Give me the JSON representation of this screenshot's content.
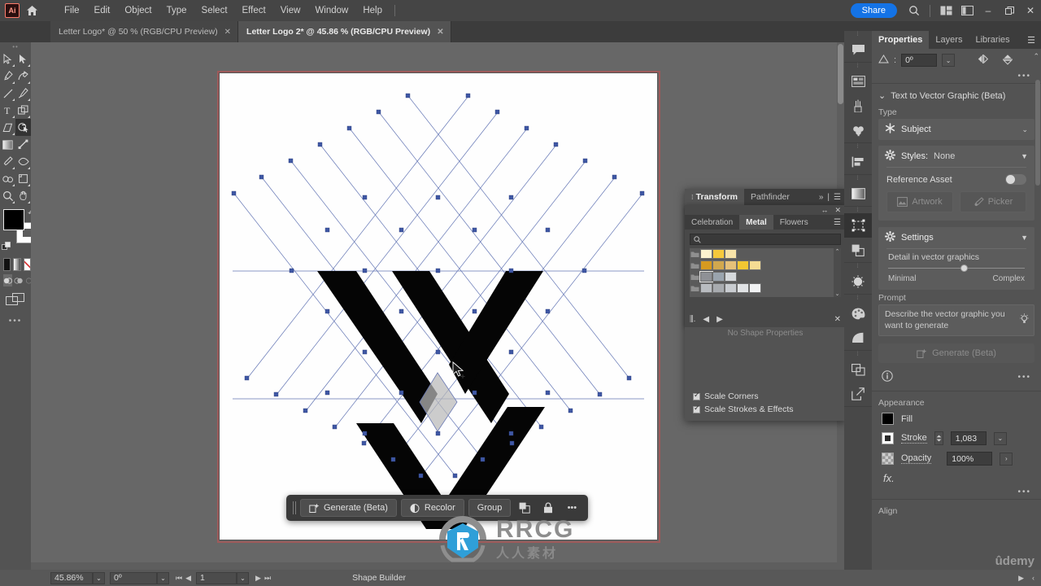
{
  "app": {
    "logo": "Ai",
    "home_icon": "home-icon",
    "menus": [
      "File",
      "Edit",
      "Object",
      "Type",
      "Select",
      "Effect",
      "View",
      "Window",
      "Help"
    ],
    "share_label": "Share",
    "search_icon": "search-icon",
    "arrange_icon": "arrange-documents-icon",
    "workspace_icon": "workspace-panel-icon",
    "minimize": "–",
    "maximize": "❐",
    "close": "✕"
  },
  "tabs": [
    {
      "label": "Letter Logo* @ 50 % (RGB/CPU Preview)",
      "active": false,
      "close": "✕"
    },
    {
      "label": "Letter  Logo 2* @ 45.86 % (RGB/CPU Preview)",
      "active": true,
      "close": "✕"
    }
  ],
  "toolbar": {
    "grip": "••",
    "tools": [
      {
        "name": "selection-tool",
        "selected": false,
        "sub": true
      },
      {
        "name": "direct-selection-tool",
        "selected": false,
        "sub": true
      },
      {
        "name": "pen-tool",
        "selected": false,
        "sub": true
      },
      {
        "name": "curvature-tool",
        "selected": false,
        "sub": true
      },
      {
        "name": "line-segment-tool",
        "selected": false,
        "sub": true
      },
      {
        "name": "paintbrush-tool",
        "selected": false,
        "sub": true
      },
      {
        "name": "type-tool",
        "selected": false,
        "sub": true
      },
      {
        "name": "shape-tool",
        "selected": false,
        "sub": true
      },
      {
        "name": "eraser-tool",
        "selected": false,
        "sub": true
      },
      {
        "name": "shape-builder-tool",
        "selected": true,
        "sub": false
      },
      {
        "name": "gradient-tool",
        "selected": false,
        "sub": false
      },
      {
        "name": "free-transform-tool",
        "selected": false,
        "sub": false
      },
      {
        "name": "eyedropper-tool",
        "selected": false,
        "sub": true
      },
      {
        "name": "width-tool",
        "selected": false,
        "sub": true
      },
      {
        "name": "blend-tool",
        "selected": false,
        "sub": true
      },
      {
        "name": "artboard-tool",
        "selected": false,
        "sub": true
      },
      {
        "name": "zoom-tool",
        "selected": false,
        "sub": true
      },
      {
        "name": "hand-tool",
        "selected": false,
        "sub": true
      }
    ],
    "fill_color": "#000000",
    "stroke_color": "#ffffff",
    "mini_swatches": [
      "color-swatch",
      "gradient-swatch",
      "none-swatch"
    ],
    "draw_modes": [
      "draw-normal",
      "draw-behind",
      "draw-inside"
    ],
    "screen_mode": "screen-mode-icon",
    "more": "•••"
  },
  "canvas": {
    "artboard_bg": "#ffffff",
    "selection_border": "#9d5a5a",
    "cursor": "shape-builder-cursor"
  },
  "contextual_bar": {
    "generate_label": "Generate (Beta)",
    "recolor_label": "Recolor",
    "group_label": "Group",
    "duplicate_icon": "duplicate-icon",
    "lock_icon": "lock-icon",
    "more_icon": "•••"
  },
  "transform_panel": {
    "tabs": [
      {
        "label": "Transform",
        "active": true
      },
      {
        "label": "Pathfinder",
        "active": false
      }
    ],
    "expand": "»",
    "menu": "☰",
    "swatches_panel": {
      "collapse": "↔",
      "close": "✕",
      "tabs": [
        {
          "label": "Celebration",
          "active": false
        },
        {
          "label": "Metal",
          "active": true
        },
        {
          "label": "Flowers",
          "active": false
        }
      ],
      "menu": "☰",
      "search_placeholder": "",
      "search_icon": "search-icon",
      "rows": [
        {
          "folder": "swatch-group-folder",
          "colors": [
            "#fdf3cf",
            "#f5c93c",
            "#f7e3a8"
          ],
          "selected": -1
        },
        {
          "folder": "swatch-group-folder",
          "colors": [
            "#d79a20",
            "#d2a84e",
            "#e6c179",
            "#f2c732",
            "#f5dc93"
          ],
          "selected": -1
        },
        {
          "folder": "swatch-group-folder",
          "colors": [
            "#8f9196",
            "#9aa4ae",
            "#d6d9dc"
          ],
          "selected": 0
        },
        {
          "folder": "swatch-group-folder",
          "colors": [
            "#b9bcc0",
            "#a8abaf",
            "#c9ccd0",
            "#e1e3e5",
            "#f2f3f4"
          ],
          "selected": -1
        }
      ],
      "footer_icons": [
        "swatch-libraries-icon",
        "previous-icon",
        "next-icon",
        "delete-swatch-icon"
      ]
    },
    "no_shape_properties": "No Shape Properties",
    "checkboxes": [
      {
        "label": "Scale Corners",
        "checked": true
      },
      {
        "label": "Scale Strokes & Effects",
        "checked": true
      }
    ]
  },
  "rail": {
    "groups": [
      [
        "comment-icon"
      ],
      [
        "asset-export-icon",
        "brushes-icon",
        "symbols-icon"
      ],
      [
        "align-icon"
      ],
      [
        "gradient-icon"
      ],
      [
        "properties-icon",
        "layers-icon"
      ],
      [
        "image-trace-icon"
      ],
      [
        "color-icon",
        "gradient-panel-icon"
      ],
      [
        "pathfinder-icon",
        "export-icon"
      ]
    ]
  },
  "properties": {
    "tabs": [
      {
        "label": "Properties",
        "active": true
      },
      {
        "label": "Layers",
        "active": false
      },
      {
        "label": "Libraries",
        "active": false
      }
    ],
    "menu": "☰",
    "shear_icon": "shear-icon",
    "shear_value": "0º",
    "flip_h_icon": "flip-horizontal-icon",
    "flip_v_icon": "flip-vertical-icon",
    "more_dots": "•••",
    "t2v": {
      "title": "Text to Vector Graphic (Beta)",
      "collapse_icon": "chevron-down-icon",
      "type_label": "Type",
      "type_icon": "subject-icon",
      "type_value": "Subject",
      "type_caret": "⌄",
      "styles_icon": "gear-icon",
      "styles_label": "Styles:",
      "styles_value": "None",
      "styles_caret": "▼",
      "reference_asset_label": "Reference Asset",
      "reference_asset_on": false,
      "artwork_label": "Artwork",
      "artwork_icon": "artwork-icon",
      "picker_label": "Picker",
      "picker_icon": "picker-icon"
    },
    "settings": {
      "icon": "gear-icon",
      "title": "Settings",
      "caret": "▼",
      "slider_label": "Detail in vector graphics",
      "slider_min_label": "Minimal",
      "slider_max_label": "Complex",
      "slider_percent": 53
    },
    "prompt": {
      "label": "Prompt",
      "placeholder": "Describe the vector graphic you want to generate",
      "bulb_icon": "idea-bulb-icon",
      "generate_label": "Generate (Beta)",
      "generate_icon": "generate-icon"
    },
    "info_icon": "info-icon",
    "info_dots": "•••",
    "appearance": {
      "title": "Appearance",
      "fill_label": "Fill",
      "fill_color": "#000000",
      "stroke_label": "Stroke",
      "stroke_value": "1,083",
      "stroke_caret": "⌄",
      "opacity_label": "Opacity",
      "opacity_value": "100%",
      "opacity_caret": "›",
      "fx_label": "fx.",
      "more_dots": "•••"
    },
    "align": {
      "title": "Align"
    }
  },
  "statusbar": {
    "zoom_value": "45.86%",
    "zoom_caret": "⌄",
    "rotate_value": "0º",
    "rotate_caret": "⌄",
    "first_icon": "⏮",
    "prev_icon": "◀",
    "page_value": "1",
    "page_caret": "⌄",
    "next_icon": "▶",
    "last_icon": "⏭",
    "tool_name": "Shape Builder",
    "play_icon": "▶",
    "collapse_icon": "‹"
  },
  "watermark": {
    "brand": "RRCG",
    "sub": "人人素材",
    "udemy": "ûdemy"
  }
}
